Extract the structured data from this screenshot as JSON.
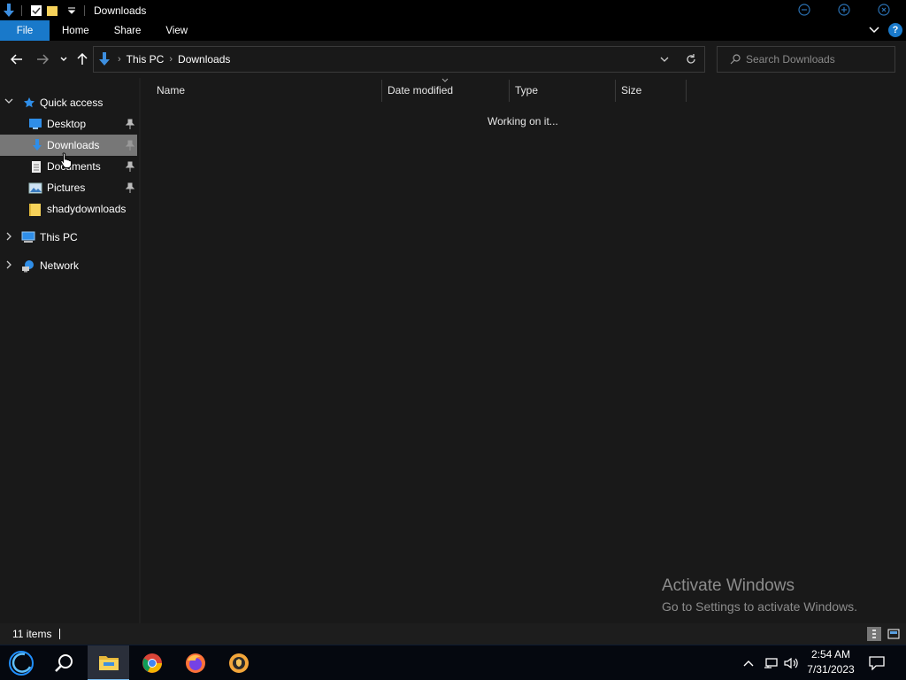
{
  "window": {
    "title": "Downloads"
  },
  "ribbon": {
    "tabs": [
      "File",
      "Home",
      "Share",
      "View"
    ]
  },
  "address": {
    "crumbs": [
      "This PC",
      "Downloads"
    ]
  },
  "search": {
    "placeholder": "Search Downloads"
  },
  "navpane": {
    "quick_access": "Quick access",
    "items": [
      "Desktop",
      "Downloads",
      "Documents",
      "Pictures",
      "shadydownloads"
    ],
    "this_pc": "This PC",
    "network": "Network"
  },
  "columns": [
    "Name",
    "Date modified",
    "Type",
    "Size"
  ],
  "content": {
    "status": "Working on it..."
  },
  "watermark": {
    "line1": "Activate Windows",
    "line2": "Go to Settings to activate Windows."
  },
  "statusbar": {
    "item_count": "11 items"
  },
  "taskbar": {
    "time": "2:54 AM",
    "date": "7/31/2023"
  },
  "colors": {
    "accent": "#1979ca",
    "selected": "#777777",
    "background": "#191919"
  },
  "icons": {
    "qat": [
      "download-arrow-icon",
      "properties-icon",
      "new-folder-icon"
    ],
    "taskbar": [
      "start-icon",
      "search-icon",
      "file-explorer-icon",
      "chrome-icon",
      "firefox-icon",
      "vpn-icon"
    ]
  }
}
